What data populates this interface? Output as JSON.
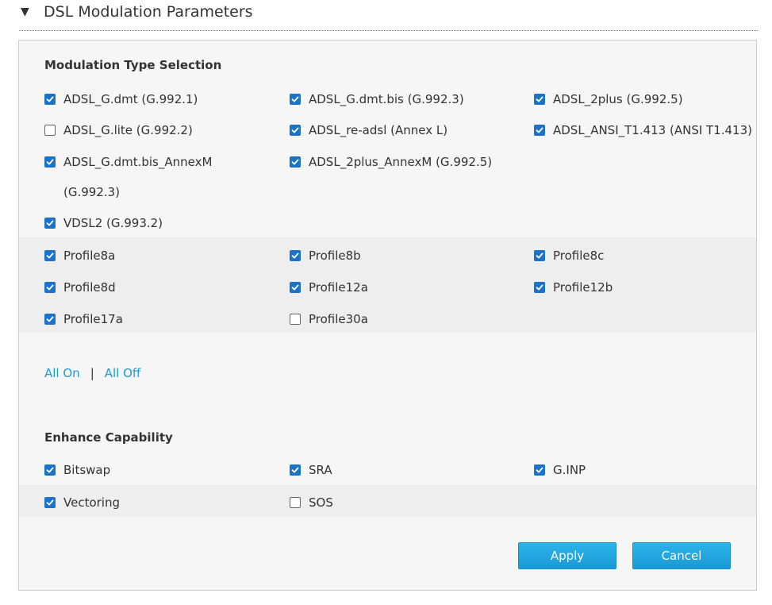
{
  "header": {
    "arrow": "▼",
    "title": "DSL Modulation Parameters"
  },
  "modulation": {
    "title": "Modulation Type Selection",
    "items": [
      {
        "label": "ADSL_G.dmt (G.992.1)",
        "checked": true
      },
      {
        "label": "ADSL_G.dmt.bis (G.992.3)",
        "checked": true
      },
      {
        "label": "ADSL_2plus (G.992.5)",
        "checked": true
      },
      {
        "label": "ADSL_G.lite (G.992.2)",
        "checked": false
      },
      {
        "label": "ADSL_re-adsl (Annex L)",
        "checked": true
      },
      {
        "label": "ADSL_ANSI_T1.413 (ANSI T1.413)",
        "checked": true
      },
      {
        "label": "ADSL_G.dmt.bis_AnnexM (G.992.3)",
        "checked": true
      },
      {
        "label": "ADSL_2plus_AnnexM (G.992.5)",
        "checked": true
      },
      {
        "label": "VDSL2 (G.993.2)",
        "checked": true
      }
    ]
  },
  "profiles": {
    "items": [
      {
        "label": "Profile8a",
        "checked": true
      },
      {
        "label": "Profile8b",
        "checked": true
      },
      {
        "label": "Profile8c",
        "checked": true
      },
      {
        "label": "Profile8d",
        "checked": true
      },
      {
        "label": "Profile12a",
        "checked": true
      },
      {
        "label": "Profile12b",
        "checked": true
      },
      {
        "label": "Profile17a",
        "checked": true
      },
      {
        "label": "Profile30a",
        "checked": false
      }
    ]
  },
  "links": {
    "all_on": "All On",
    "separator": "|",
    "all_off": "All Off"
  },
  "enhance": {
    "title": "Enhance Capability",
    "items": [
      {
        "label": "Bitswap",
        "checked": true
      },
      {
        "label": "SRA",
        "checked": true
      },
      {
        "label": "G.INP",
        "checked": true
      },
      {
        "label": "Vectoring",
        "checked": true
      },
      {
        "label": "SOS",
        "checked": false
      }
    ]
  },
  "buttons": {
    "apply": "Apply",
    "cancel": "Cancel"
  },
  "colors": {
    "accent": "#1a73c8",
    "link": "#1a9bd7",
    "button": "#1fa6de",
    "panel": "#f6f6f6",
    "band": "#eeeeee"
  }
}
